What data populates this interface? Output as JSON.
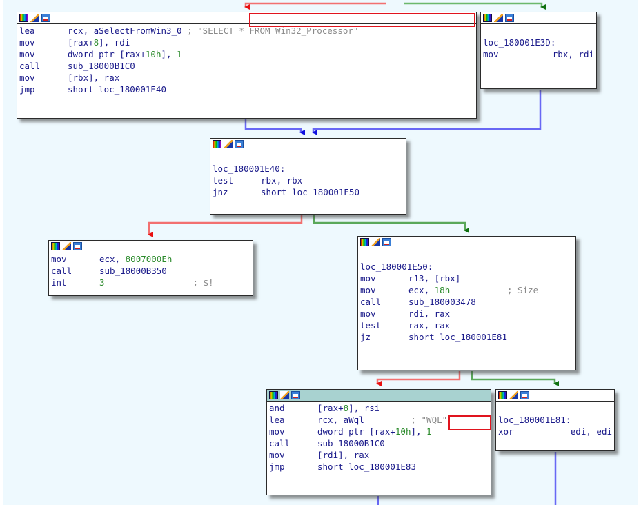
{
  "app": "IDA graph view",
  "colors": {
    "canvas_bg": "#eef9fe",
    "edge_true": "#3c9a3c",
    "edge_false": "#f06464",
    "edge_uncond": "#6464f0",
    "highlight": "#e0141e",
    "instr_text": "#1a1a8a",
    "number": "#2b8a2b",
    "comment": "#8a8a8a",
    "active_header": "#a8d2d0"
  },
  "header_icons": [
    "color-palette-icon",
    "edit-pencil-icon",
    "graph-overview-icon"
  ],
  "blocks": {
    "a": {
      "lines": [
        {
          "mn": "lea",
          "op": "rcx, aSelectFromWin3_0 ",
          "cmt": "; \"SELECT * FROM Win32_Processor\""
        },
        {
          "mn": "mov",
          "op": "[rax+",
          "num": "8",
          "op2": "], rdi"
        },
        {
          "mn": "mov",
          "op": "dword ptr [rax+",
          "num": "10h",
          "op2": "], ",
          "num2": "1"
        },
        {
          "mn": "call",
          "op": "sub_18000B1C0"
        },
        {
          "mn": "mov",
          "op": "[rbx], rax"
        },
        {
          "mn": "jmp",
          "op": "short loc_180001E40"
        }
      ]
    },
    "b": {
      "label": "loc_180001E3D:",
      "lines": [
        {
          "mn": "mov",
          "op": "     rbx, rdi"
        }
      ]
    },
    "c": {
      "label": "loc_180001E40:",
      "lines": [
        {
          "mn": "test",
          "op": "rbx, rbx"
        },
        {
          "mn": "jnz",
          "op": "short loc_180001E50"
        }
      ]
    },
    "d": {
      "lines": [
        {
          "mn": "mov",
          "op": "ecx, ",
          "num": "8007000Eh"
        },
        {
          "mn": "call",
          "op": "sub_18000B350"
        },
        {
          "mn": "int",
          "num": "3",
          "cmt": "                 ; $!"
        }
      ]
    },
    "e": {
      "label": "loc_180001E50:",
      "lines": [
        {
          "mn": "mov",
          "op": "r13, [rbx]"
        },
        {
          "mn": "mov",
          "op": "ecx, ",
          "num": "18h",
          "cmt": "           ; Size"
        },
        {
          "mn": "call",
          "op": "sub_180003478"
        },
        {
          "mn": "mov",
          "op": "rdi, rax"
        },
        {
          "mn": "test",
          "op": "rax, rax"
        },
        {
          "mn": "jz",
          "op": "short loc_180001E81"
        }
      ]
    },
    "f": {
      "lines": [
        {
          "mn": "and",
          "op": "[rax+",
          "num": "8",
          "op2": "], rsi"
        },
        {
          "mn": "lea",
          "op": "rcx, aWql         ",
          "cmt": "; \"WQL\""
        },
        {
          "mn": "mov",
          "op": "dword ptr [rax+",
          "num": "10h",
          "op2": "], ",
          "num2": "1"
        },
        {
          "mn": "call",
          "op": "sub_18000B1C0"
        },
        {
          "mn": "mov",
          "op": "[rdi], rax"
        },
        {
          "mn": "jmp",
          "op": "short loc_180001E83"
        }
      ]
    },
    "g": {
      "label": "loc_180001E81:",
      "lines": [
        {
          "mn": "xor",
          "op": "     edi, edi"
        }
      ]
    }
  },
  "highlights": [
    "\"SELECT * FROM Win32_Processor\"",
    "\"WQL\""
  ]
}
